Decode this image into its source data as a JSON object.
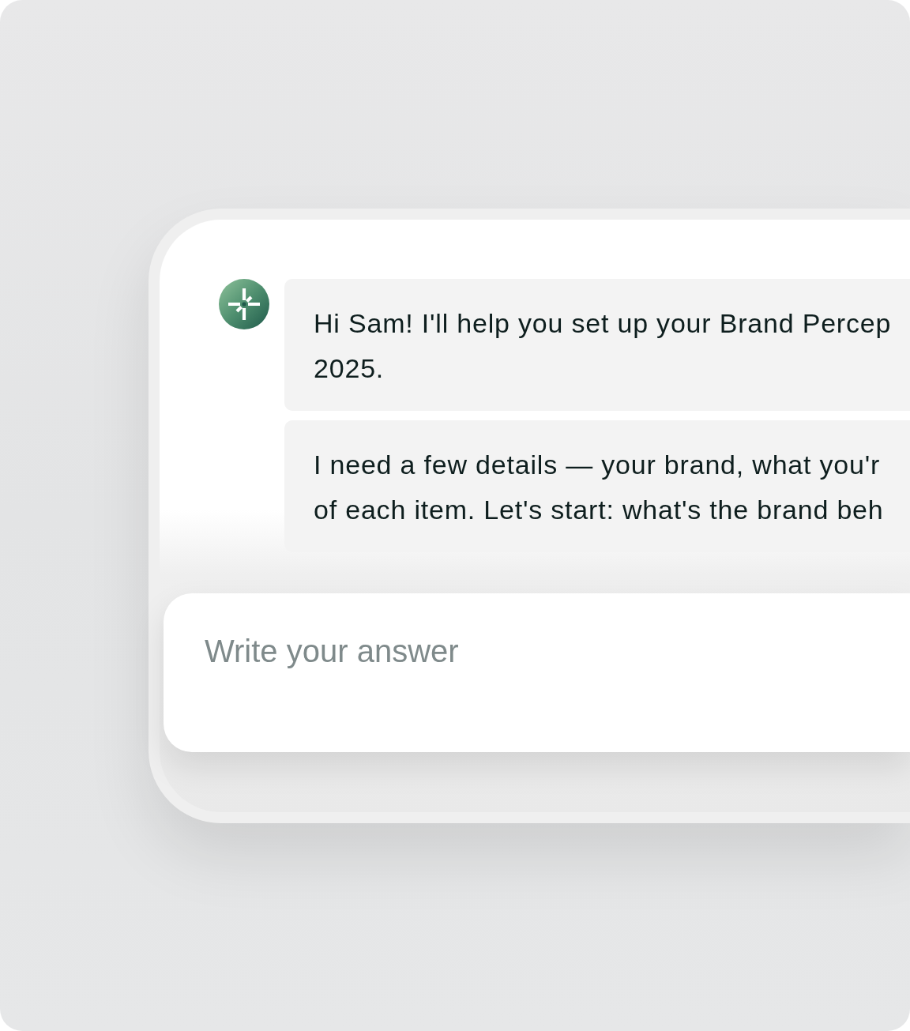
{
  "conversation": {
    "messages": [
      {
        "lines": [
          "Hi Sam! I'll help you set up your Brand Percep",
          "2025."
        ]
      },
      {
        "lines": [
          "I need a few details — your brand, what you'r",
          "of each item. Let's start: what's the brand beh"
        ]
      }
    ]
  },
  "answer_field": {
    "placeholder": "Write your answer"
  }
}
